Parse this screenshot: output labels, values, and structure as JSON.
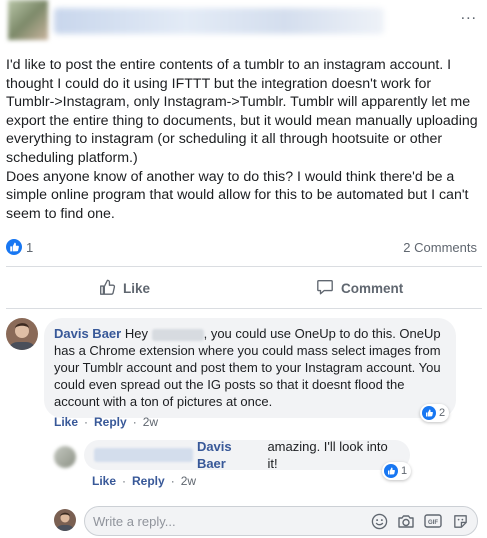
{
  "post": {
    "text": "I'd like to post the entire contents of a tumblr to an instagram account. I thought I could do it using IFTTT but the integration doesn't work for Tumblr->Instagram, only Instagram->Tumblr. Tumblr will apparently let me export the entire thing to documents, but it would mean manually uploading everything to instagram (or scheduling it all through hootsuite or other scheduling platform.)\nDoes anyone know of another way to do this? I would think there'd be a simple online program that would allow for this to be automated but I can't seem to find one.",
    "like_count": "1",
    "comments_count": "2 Comments",
    "more_icon": "..."
  },
  "actions": {
    "like_label": "Like",
    "comment_label": "Comment"
  },
  "comments": [
    {
      "author": "Davis Baer",
      "text_before": "Hey",
      "text_after": ", you could use OneUp to do this. OneUp has a Chrome extension where you could mass select images from your Tumblr account and post them to your Instagram account. You could even spread out the IG posts so that it doesnt flood the account with a ton of pictures at once.",
      "like_label": "Like",
      "reply_label": "Reply",
      "time": "2w",
      "reaction_count": "2"
    }
  ],
  "reply": {
    "author": "Davis Baer",
    "text": "amazing. I'll look into it!",
    "like_label": "Like",
    "reply_label": "Reply",
    "time": "2w",
    "reaction_count": "1"
  },
  "reply_box": {
    "placeholder": "Write a reply..."
  },
  "colors": {
    "accent": "#1877f2",
    "link": "#385898",
    "muted": "#606770",
    "bubble": "#f2f3f5"
  },
  "icons": [
    "more-icon",
    "like-reaction-icon",
    "thumbs-up-icon",
    "comment-icon",
    "emoji-icon",
    "camera-icon",
    "gif-icon",
    "sticker-icon"
  ]
}
